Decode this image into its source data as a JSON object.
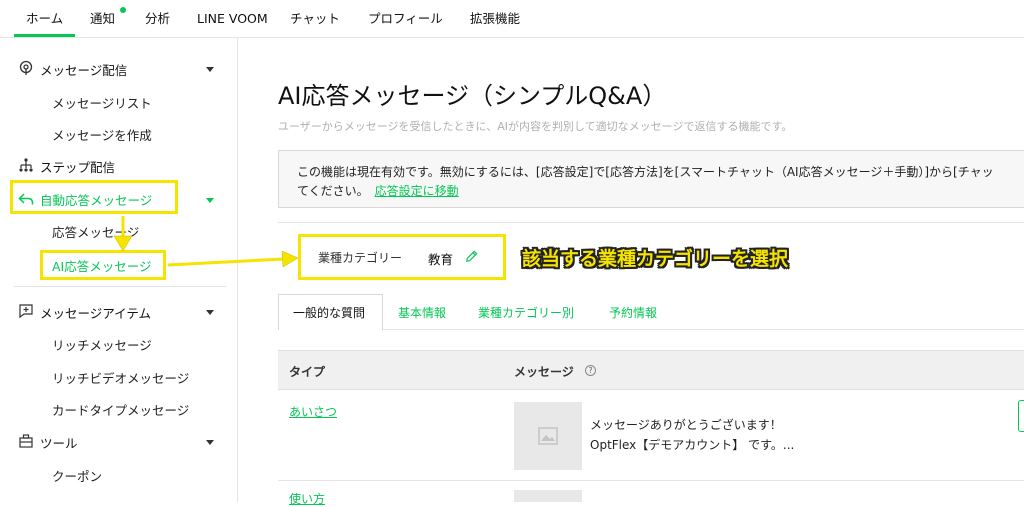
{
  "topnav": {
    "tabs": [
      "ホーム",
      "通知",
      "分析",
      "LINE VOOM",
      "チャット",
      "プロフィール",
      "拡張機能"
    ]
  },
  "sidebar": {
    "message_delivery": "メッセージ配信",
    "message_list": "メッセージリスト",
    "create_message": "メッセージを作成",
    "step_delivery": "ステップ配信",
    "auto_response": "自動応答メッセージ",
    "response_message": "応答メッセージ",
    "ai_response": "AI応答メッセージ",
    "message_items": "メッセージアイテム",
    "rich_message": "リッチメッセージ",
    "rich_video": "リッチビデオメッセージ",
    "card_type": "カードタイプメッセージ",
    "tools": "ツール",
    "coupon": "クーポン"
  },
  "main": {
    "title": "AI応答メッセージ（シンプルQ&A）",
    "description": "ユーザーからメッセージを受信したときに、AIが内容を判別して適切なメッセージで返信する機能です。",
    "notice_line1": "この機能は現在有効です。無効にするには、[応答設定]で[応答方法]を[スマートチャット（AI応答メッセージ＋手動）]から[チャッ",
    "notice_line2_prefix": "てください。",
    "notice_link": "応答設定に移動",
    "industry_label": "業種カテゴリー",
    "industry_value": "教育",
    "annotation": "該当する業種カテゴリーを選択",
    "subtabs": [
      "一般的な質問",
      "基本情報",
      "業種カテゴリー別",
      "予約情報"
    ],
    "table": {
      "col_type": "タイプ",
      "col_message": "メッセージ",
      "rows": [
        {
          "type": "あいさつ",
          "line1": "メッセージありがとうございます！",
          "line2": "OptFlex【デモアカウント】 です。..."
        },
        {
          "type": "使い方",
          "line1": "",
          "line2": ""
        }
      ]
    }
  },
  "colors": {
    "accent": "#06c755",
    "highlight": "#f5e300"
  }
}
